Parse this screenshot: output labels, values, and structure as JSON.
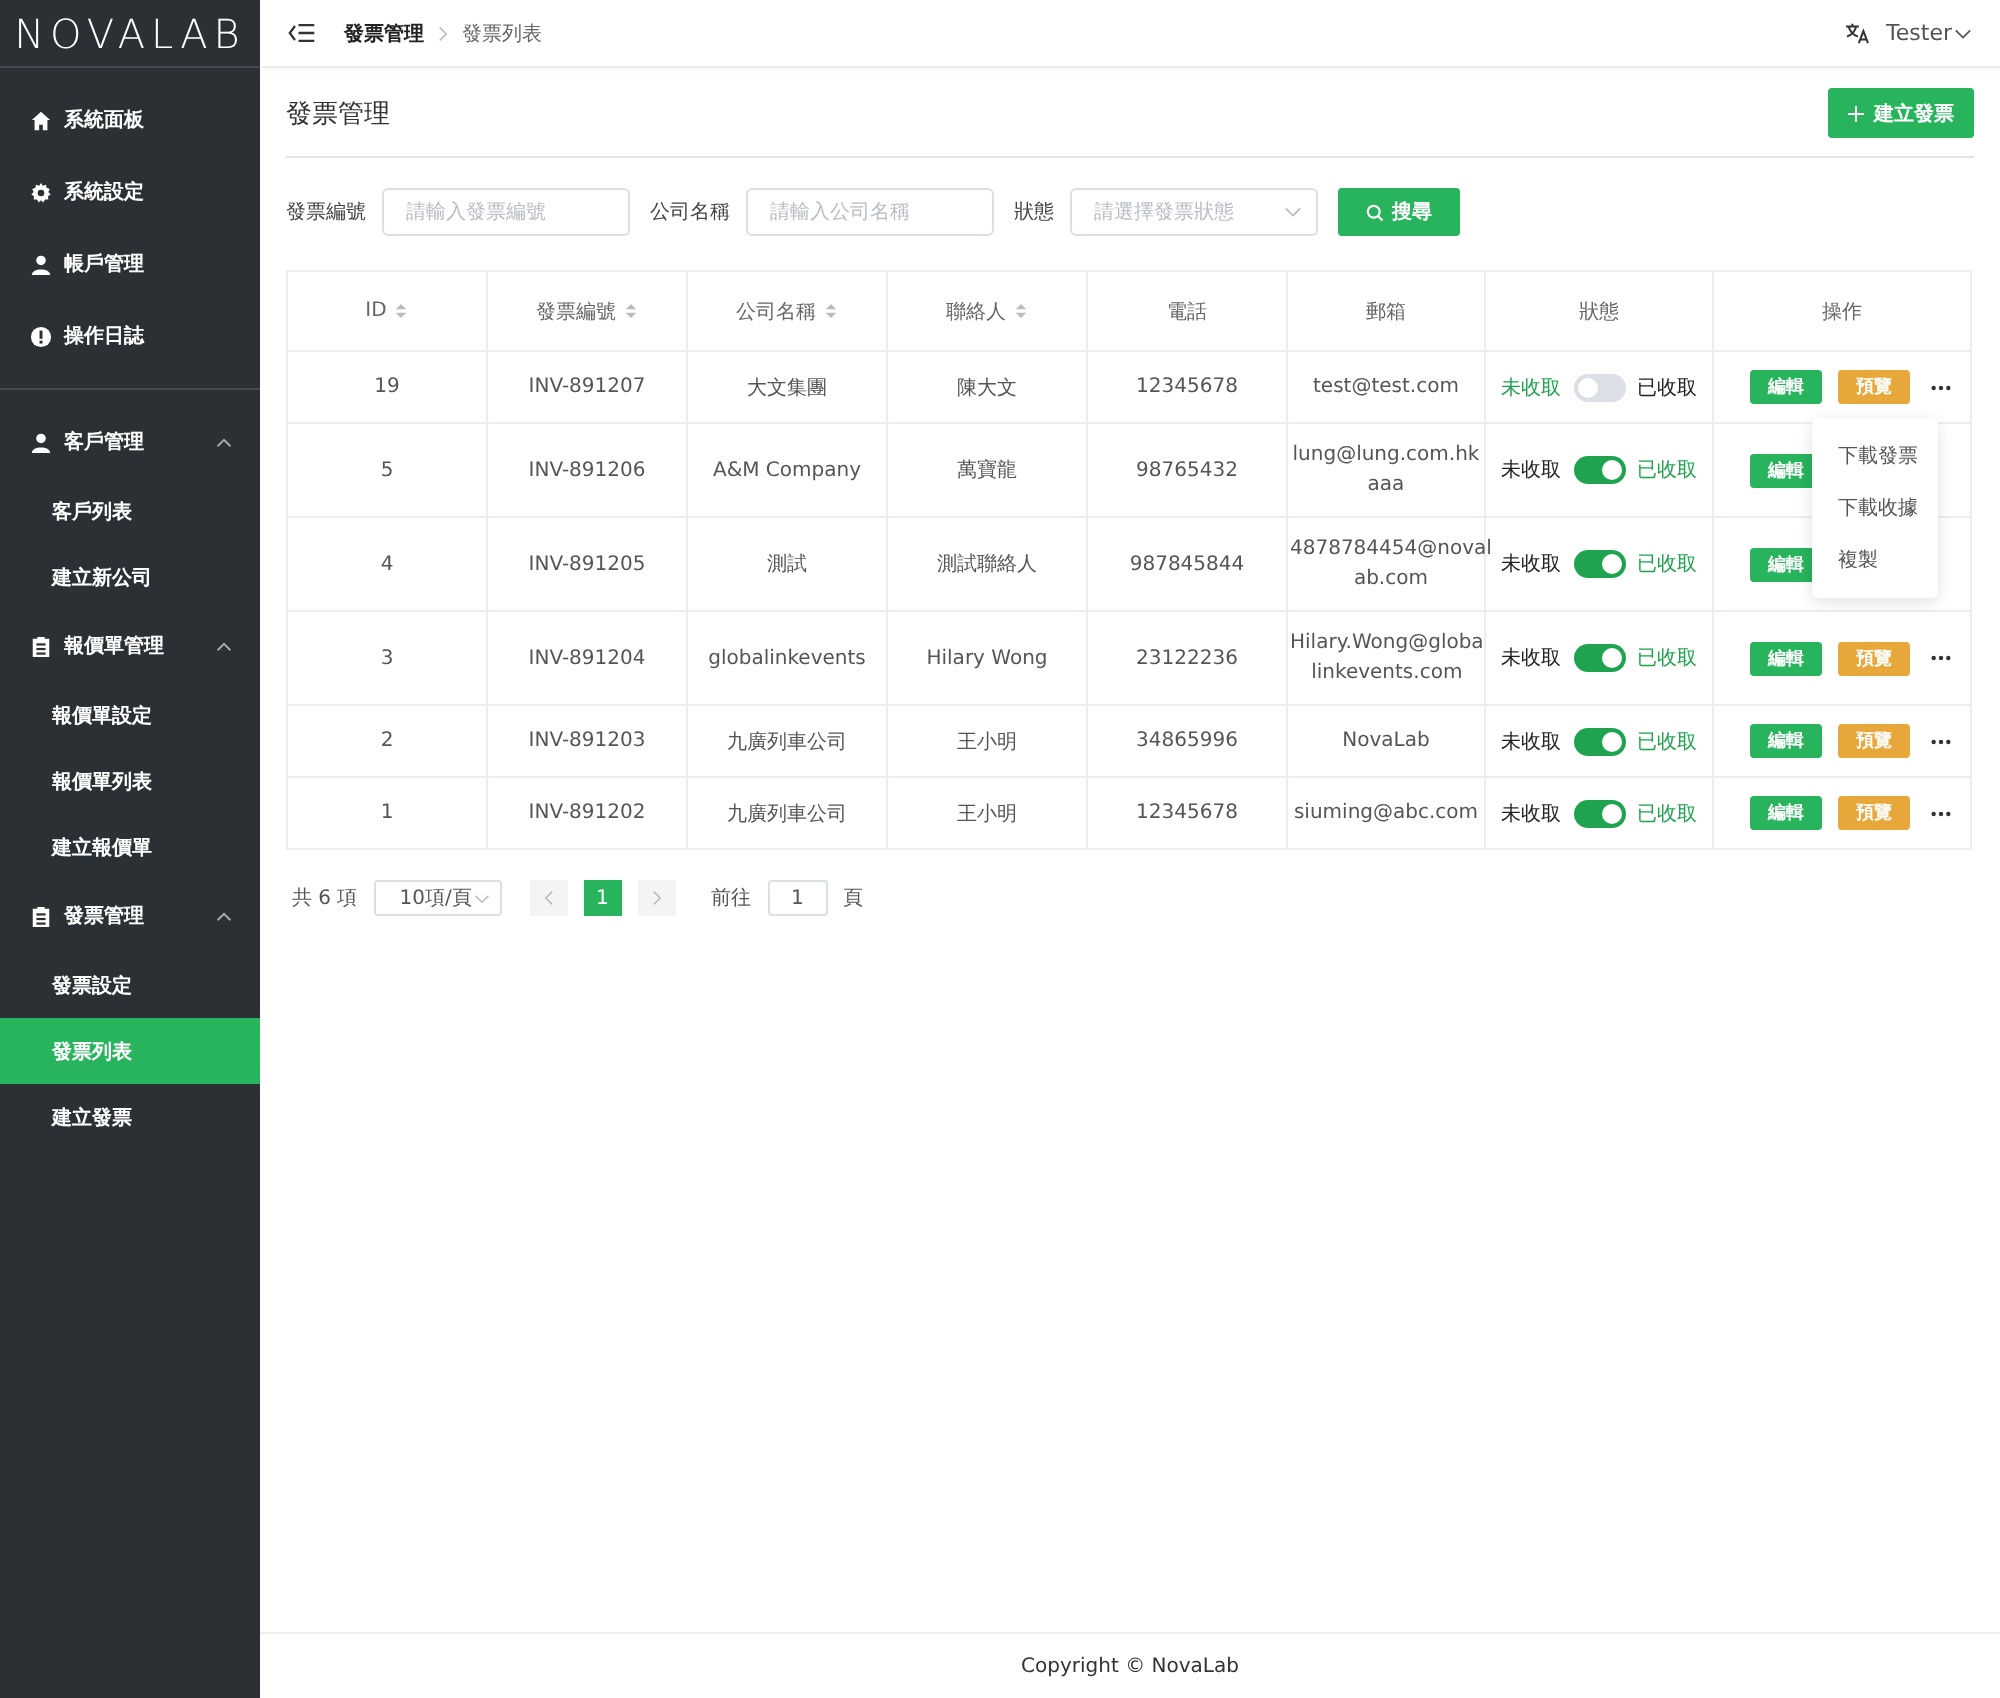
{
  "logo": "NOVALAB",
  "sidebar": {
    "groups": [
      {
        "items": [
          {
            "label": "系統面板",
            "selected": false
          },
          {
            "label": "系統設定",
            "selected": false
          },
          {
            "label": "帳戶管理",
            "selected": false
          },
          {
            "label": "操作日誌",
            "selected": false
          }
        ]
      },
      {
        "items": [
          {
            "label": "客戶管理",
            "selected": false,
            "expanded": true,
            "children": [
              {
                "label": "客戶列表",
                "selected": false
              },
              {
                "label": "建立新公司",
                "selected": false
              }
            ]
          },
          {
            "label": "報價單管理",
            "selected": false,
            "expanded": true,
            "children": [
              {
                "label": "報價單設定",
                "selected": false
              },
              {
                "label": "報價單列表",
                "selected": false
              },
              {
                "label": "建立報價單",
                "selected": false
              }
            ]
          },
          {
            "label": "發票管理",
            "selected": false,
            "expanded": true,
            "children": [
              {
                "label": "發票設定",
                "selected": false
              },
              {
                "label": "發票列表",
                "selected": true
              },
              {
                "label": "建立發票",
                "selected": false
              }
            ]
          }
        ]
      }
    ]
  },
  "breadcrumb": [
    "發票管理",
    "發票列表"
  ],
  "user": {
    "name": "Tester"
  },
  "page_title": "發票管理",
  "create_button": "建立發票",
  "filters": [
    {
      "label": "發票編號",
      "placeholder": "請輸入發票編號",
      "kind": "input"
    },
    {
      "label": "公司名稱",
      "placeholder": "請輸入公司名稱",
      "kind": "input"
    },
    {
      "label": "狀態",
      "placeholder": "請選擇發票狀態",
      "kind": "select"
    }
  ],
  "search_button": "搜尋",
  "table": {
    "columns": [
      "ID",
      "發票編號",
      "公司名稱",
      "聯絡人",
      "電話",
      "郵箱",
      "狀態",
      "操作"
    ],
    "rows": [
      {
        "id": "19",
        "number": "INV-891207",
        "company": "大文集團",
        "contact": "陳大文",
        "phone": "12345678",
        "email": [
          "test@test.com"
        ],
        "status": {
          "off_label": "未收取",
          "on_label": "已收取",
          "on": false
        },
        "edit": "編輯",
        "preview": "預覽"
      },
      {
        "id": "5",
        "number": "INV-891206",
        "company": "A&M Company",
        "contact": "萬寶龍",
        "phone": "98765432",
        "email": [
          "lung@lung.com.hk",
          "aaa"
        ],
        "status": {
          "off_label": "未收取",
          "on_label": "已收取",
          "on": true
        },
        "edit": "編輯"
      },
      {
        "id": "4",
        "number": "INV-891205",
        "company": "測試",
        "contact": "測試聯絡人",
        "phone": "987845844",
        "email": [
          "4878784454@noval",
          "ab.com"
        ],
        "status": {
          "off_label": "未收取",
          "on_label": "已收取",
          "on": true
        },
        "edit": "編輯"
      },
      {
        "id": "3",
        "number": "INV-891204",
        "company": "globalinkevents",
        "contact": "Hilary Wong",
        "phone": "23122236",
        "email": [
          "Hilary.Wong@globa",
          "linkevents.com"
        ],
        "status": {
          "off_label": "未收取",
          "on_label": "已收取",
          "on": true
        },
        "edit": "編輯",
        "preview": "預覽"
      },
      {
        "id": "2",
        "number": "INV-891203",
        "company": "九廣列車公司",
        "contact": "王小明",
        "phone": "34865996",
        "email": [
          "NovaLab"
        ],
        "status": {
          "off_label": "未收取",
          "on_label": "已收取",
          "on": true
        },
        "edit": "編輯",
        "preview": "預覽"
      },
      {
        "id": "1",
        "number": "INV-891202",
        "company": "九廣列車公司",
        "contact": "王小明",
        "phone": "12345678",
        "email": [
          "siuming@abc.com"
        ],
        "status": {
          "off_label": "未收取",
          "on_label": "已收取",
          "on": true
        },
        "edit": "編輯",
        "preview": "預覽"
      }
    ]
  },
  "dropdown_menu": [
    "下載發票",
    "下載收據",
    "複製"
  ],
  "pagination": {
    "total": "共 6 項",
    "page_size": "10項/頁",
    "pages": [
      {
        "label": "1",
        "selected": true
      }
    ],
    "goto_label": "前往",
    "goto_value": "1",
    "page_suffix": "頁"
  },
  "footer": "Copyright © NovaLab"
}
